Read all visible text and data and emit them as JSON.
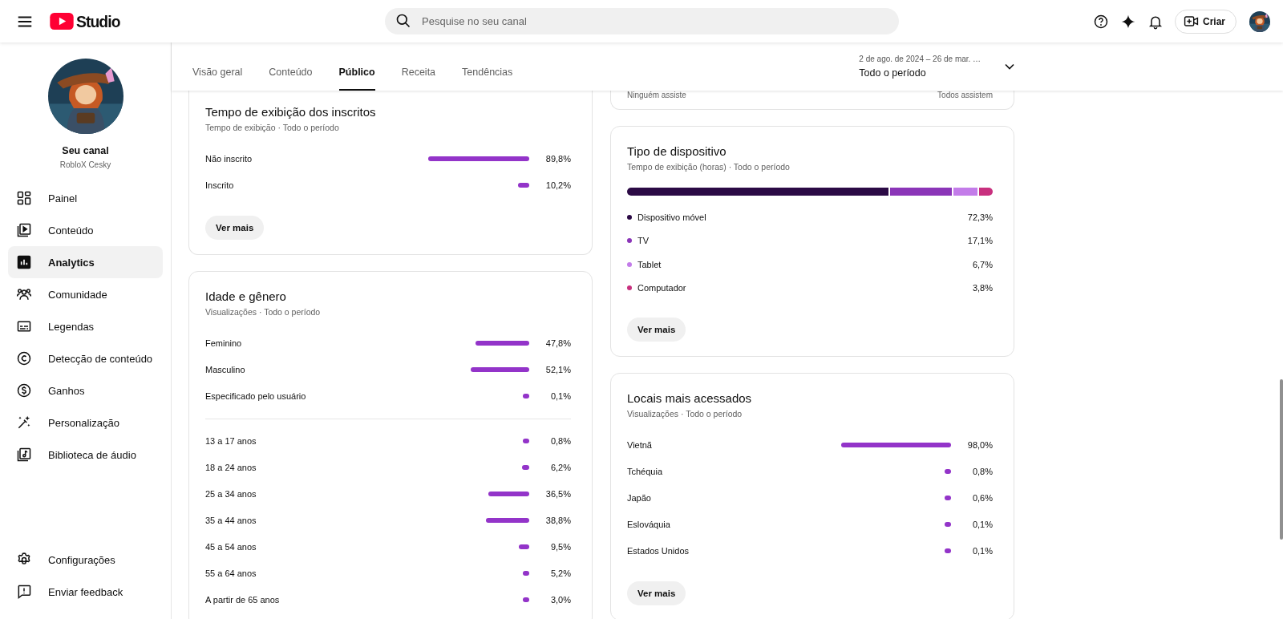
{
  "header": {
    "logo_text": "Studio",
    "search": {
      "placeholder": "Pesquise no seu canal"
    },
    "create_label": "Criar"
  },
  "channel": {
    "title": "Seu canal",
    "name": "RobloX Cesky"
  },
  "sidebar": {
    "items": [
      {
        "label": "Painel",
        "selected": false
      },
      {
        "label": "Conteúdo",
        "selected": false
      },
      {
        "label": "Analytics",
        "selected": true
      },
      {
        "label": "Comunidade",
        "selected": false
      },
      {
        "label": "Legendas",
        "selected": false
      },
      {
        "label": "Detecção de conteúdo",
        "selected": false
      },
      {
        "label": "Ganhos",
        "selected": false
      },
      {
        "label": "Personalização",
        "selected": false
      },
      {
        "label": "Biblioteca de áudio",
        "selected": false
      }
    ],
    "footer_items": [
      {
        "label": "Configurações",
        "selected": false
      },
      {
        "label": "Enviar feedback",
        "selected": false
      }
    ]
  },
  "tabs": [
    {
      "label": "Visão geral",
      "selected": false
    },
    {
      "label": "Conteúdo",
      "selected": false
    },
    {
      "label": "Público",
      "selected": true
    },
    {
      "label": "Receita",
      "selected": false
    },
    {
      "label": "Tendências",
      "selected": false
    }
  ],
  "date_range": {
    "range": "2 de ago. de 2024 – 26 de mar. …",
    "period": "Todo o período"
  },
  "columns": [
    {
      "cards": [
        {
          "kind": "bars",
          "title": "Tempo de exibição dos inscritos",
          "subtitle": "Tempo de exibição · Todo o período",
          "groups": [
            {
              "rows": [
                {
                  "label": "Não inscrito",
                  "value": "89,8%"
                },
                {
                  "label": "Inscrito",
                  "value": "10,2%"
                }
              ]
            }
          ],
          "button": "Ver mais"
        },
        {
          "kind": "bars",
          "title": "Idade e gênero",
          "subtitle": "Visualizações · Todo o período",
          "groups": [
            {
              "rows": [
                {
                  "label": "Feminino",
                  "value": "47,8%"
                },
                {
                  "label": "Masculino",
                  "value": "52,1%"
                },
                {
                  "label": "Especificado pelo usuário",
                  "value": "0,1%"
                }
              ]
            },
            {
              "rows": [
                {
                  "label": "13 a 17 anos",
                  "value": "0,8%"
                },
                {
                  "label": "18 a 24 anos",
                  "value": "6,2%"
                },
                {
                  "label": "25 a 34 anos",
                  "value": "36,5%"
                },
                {
                  "label": "35 a 44 anos",
                  "value": "38,8%"
                },
                {
                  "label": "45 a 54 anos",
                  "value": "9,5%"
                },
                {
                  "label": "55 a 64 anos",
                  "value": "5,2%"
                },
                {
                  "label": "A partir de 65 anos",
                  "value": "3,0%"
                }
              ]
            }
          ]
        }
      ]
    },
    {
      "cards": [
        {
          "kind": "scale",
          "left_label": "Ninguém assiste",
          "right_label": "Todos assistem"
        },
        {
          "kind": "stacked",
          "title": "Tipo de dispositivo",
          "subtitle": "Tempo de exibição (horas) · Todo o período",
          "segments": [
            {
              "label": "Dispositivo móvel",
              "value": "72,3%",
              "color": "#2b0a45"
            },
            {
              "label": "TV",
              "value": "17,1%",
              "color": "#8b35b8"
            },
            {
              "label": "Tablet",
              "value": "6,7%",
              "color": "#c37ce9"
            },
            {
              "label": "Computador",
              "value": "3,8%",
              "color": "#c8307e"
            }
          ],
          "button": "Ver mais"
        },
        {
          "kind": "bars",
          "title": "Locais mais acessados",
          "subtitle": "Visualizações · Todo o período",
          "groups": [
            {
              "rows": [
                {
                  "label": "Vietnã",
                  "value": "98,0%"
                },
                {
                  "label": "Tchéquia",
                  "value": "0,8%"
                },
                {
                  "label": "Japão",
                  "value": "0,6%"
                },
                {
                  "label": "Eslováquia",
                  "value": "0,1%"
                },
                {
                  "label": "Estados Unidos",
                  "value": "0,1%"
                }
              ]
            }
          ],
          "button": "Ver mais"
        }
      ]
    }
  ]
}
